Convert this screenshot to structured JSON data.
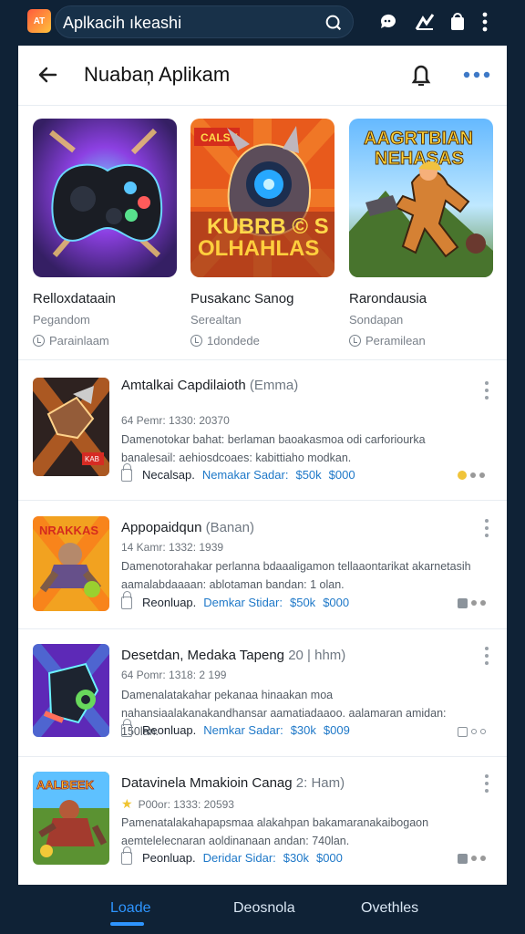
{
  "top": {
    "app_icon": "AT",
    "search_text": "Aplkacih ıkeashi",
    "icons": [
      "search-icon",
      "chat-icon",
      "chart-icon",
      "cart-icon",
      "more-vertical-icon"
    ]
  },
  "header": {
    "title": "Nuabaņ Aplikam",
    "icons": [
      "back-arrow-icon",
      "bell-icon",
      "more-horizontal-icon"
    ]
  },
  "featured": [
    {
      "name": "Relloxdataain",
      "sub": "Pegandom",
      "meta": "Parainlaam",
      "badge": ""
    },
    {
      "name": "Pusakanc Sanog",
      "sub": "Serealtan",
      "meta": "1dondede",
      "badge": "CALSY",
      "art_text": [
        "KUBRB © S",
        "OLHAHLAS"
      ]
    },
    {
      "name": "Rarondausia",
      "sub": "Sondapan",
      "meta": "Peramilean",
      "badge": "",
      "art_text": [
        "AAGRTBIAN",
        "NEHASAS"
      ]
    }
  ],
  "list": [
    {
      "title_main": "Amtalkai Capdilaioth",
      "title_paren": "(Emma)",
      "meta": "64 Pemr: 1330: 20370",
      "desc": "Damenotokar bahat: berlaman baoakasmoa odi carforiourka banalesail: aehiosdcoaes: kabittiaho modkan.",
      "foot": [
        "Necalsap.",
        "Nemakar Sadar:",
        "$50k",
        "$000"
      ],
      "mini": "yellow",
      "badge_text": "KAB"
    },
    {
      "title_main": "Appopaidqun",
      "title_paren": "(Banan)",
      "meta": "14 Kamr: 1332: 1939",
      "desc": "Damenotorahakar perlanna bdaaaligamon tellaaontarikat akarnetasih aamalabdaaaan: ablotaman bandan: 1 olan.",
      "foot": [
        "Reonluap.",
        "Demkar Stidar:",
        "$50k",
        "$000"
      ],
      "mini": "gray",
      "badge_text": "NRAKKAS"
    },
    {
      "title_main": "Desetdan, Medaka Tapeng",
      "title_paren": "20 | hhm)",
      "meta": "64 Pomr: 1318: 2 199",
      "desc": "Damenalatakahar pekanaa hinaakan moa nahansiaalakanakandhansar aamatiadaaoo. aalamaran amidan: 150lan.",
      "foot": [
        "Reonluap.",
        "Nemkar Sadar:",
        "$30k",
        "$009"
      ],
      "mini": "plain",
      "badge_text": ""
    },
    {
      "title_main": "Datavinela Mmakioin Canag",
      "title_paren": "2: Ham)",
      "meta": "P00or: 1333: 20593",
      "desc": "Pamenatalakahapapsmaa alakahpan bakamaranakaibogaon aemtelelecnaran aoldinanaan andan: 740lan.",
      "foot": [
        "Peonluap.",
        "Deridar Sidar:",
        "$30k",
        "$000"
      ],
      "mini": "gray",
      "badge_text": "AALBEEK"
    }
  ],
  "bottom_nav": [
    "Loade",
    "Deosnola",
    "Ovethles"
  ],
  "colors": {
    "accent": "#2e95ff",
    "dark": "#0f2236"
  }
}
